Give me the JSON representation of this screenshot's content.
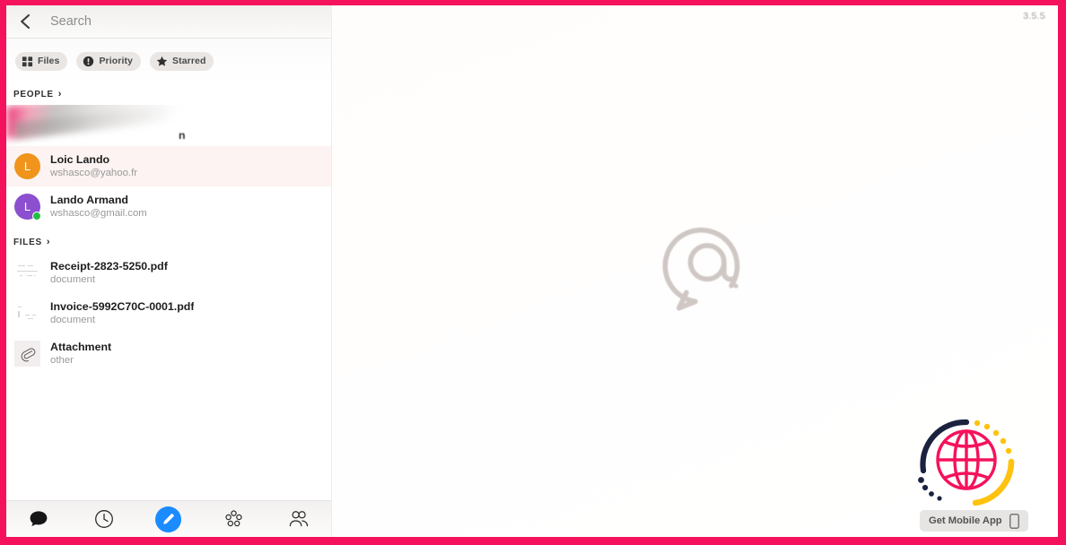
{
  "app": {
    "version": "3.5.5",
    "accent_pink": "#f5125c",
    "fab_blue": "#1a8cff",
    "selected_row_bg": "#fcf3f2"
  },
  "search": {
    "placeholder": "Search",
    "value": "",
    "back_icon": "back-chevron-icon"
  },
  "filters": [
    {
      "label": "Files",
      "icon": "grid-icon"
    },
    {
      "label": "Priority",
      "icon": "exclamation-circle-icon"
    },
    {
      "label": "Starred",
      "icon": "star-icon"
    }
  ],
  "people_section": {
    "title": "PEOPLE",
    "arrow": "›",
    "items": [
      {
        "name": "",
        "email": "",
        "redacted": true,
        "remnant_text": "n",
        "initial": "",
        "avatar_color": "#bdbab8",
        "online": false,
        "selected": false
      },
      {
        "name": "Loic Lando",
        "email": "wshasco@yahoo.fr",
        "redacted": false,
        "initial": "L",
        "avatar_color": "#f0941c",
        "online": false,
        "selected": true
      },
      {
        "name": "Lando Armand",
        "email": "wshasco@gmail.com",
        "redacted": false,
        "initial": "L",
        "avatar_color": "#8c4fd0",
        "online": true,
        "selected": false
      }
    ]
  },
  "files_section": {
    "title": "FILES",
    "arrow": "›",
    "items": [
      {
        "name": "Receipt-2823-5250.pdf",
        "type": "document",
        "icon": "document-thumbnail-icon"
      },
      {
        "name": "Invoice-5992C70C-0001.pdf",
        "type": "document",
        "icon": "document-thumbnail-icon"
      },
      {
        "name": "Attachment",
        "type": "other",
        "icon": "paperclip-icon"
      }
    ]
  },
  "tabbar": [
    {
      "name": "chats",
      "icon": "chat-bubble-icon",
      "active": false
    },
    {
      "name": "recent",
      "icon": "clock-icon",
      "active": false
    },
    {
      "name": "compose",
      "icon": "pencil-icon",
      "active": true
    },
    {
      "name": "groups",
      "icon": "circles-icon",
      "active": false
    },
    {
      "name": "contacts",
      "icon": "people-icon",
      "active": false
    }
  ],
  "main": {
    "empty_icon": "at-speech-bubble-icon"
  },
  "promo": {
    "label": "Get Mobile App",
    "logo_icon": "globe-icon",
    "phone_icon": "mobile-phone-icon"
  }
}
